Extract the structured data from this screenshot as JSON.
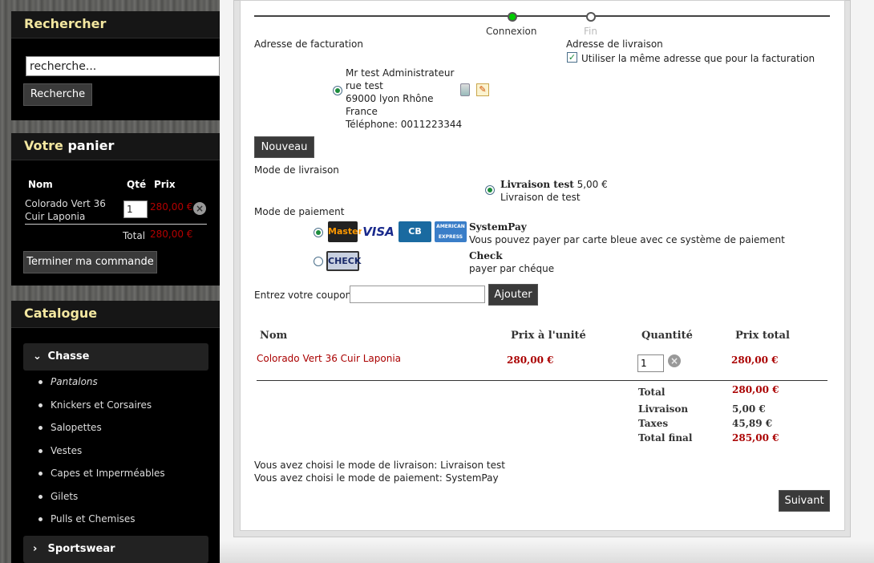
{
  "search": {
    "title": "Rechercher",
    "input_value": "recherche...",
    "button": "Recherche"
  },
  "cart": {
    "title_prefix": "Votre",
    "title_suffix": "panier",
    "col_name": "Nom",
    "col_qty": "Qté",
    "col_price": "Prix",
    "item_name_1": "Colorado Vert 36",
    "item_name_2": "Cuir Laponia",
    "item_qty": "1",
    "item_price": "280,00 €",
    "total_label": "Total",
    "total_value": "280,00 €",
    "checkout_button": "Terminer ma commande"
  },
  "catalog": {
    "title": "Catalogue",
    "group_open": "Chasse",
    "items": [
      "Pantalons",
      "Knickers et Corsaires",
      "Salopettes",
      "Vestes",
      "Capes et Imperméables",
      "Gilets",
      "Pulls et Chemises"
    ],
    "group_closed": "Sportswear"
  },
  "steps": {
    "current": "Connexion",
    "next": "Fin"
  },
  "billing": {
    "label": "Adresse de facturation",
    "name": "Mr test Administrateur",
    "street": "rue test",
    "city": "69000 lyon Rhône",
    "country": "France",
    "phone": "Téléphone: 0011223344",
    "new_button": "Nouveau"
  },
  "delivery_address": {
    "label": "Adresse de livraison",
    "same_checkbox": "Utiliser la même adresse que pour la facturation"
  },
  "shipping": {
    "label": "Mode de livraison",
    "option_name": "Livraison test",
    "option_price": "5,00 €",
    "option_desc": "Livraison de test"
  },
  "payment": {
    "label": "Mode de paiement",
    "logos": [
      "MasterCard",
      "VISA",
      "CB",
      "AMERICAN EXPRESS",
      "CHECK"
    ],
    "option1_name": "SystemPay",
    "option1_desc": "Vous pouvez payer par carte bleue avec ce système de paiement",
    "option2_name": "Check",
    "option2_desc": "payer par chéque"
  },
  "coupon": {
    "label": "Entrez votre coupon",
    "button": "Ajouter"
  },
  "order_table": {
    "headers": [
      "Nom",
      "Prix à l'unité",
      "Quantité",
      "Prix total"
    ],
    "row": {
      "name": "Colorado Vert 36 Cuir Laponia",
      "unit_price": "280,00 €",
      "qty": "1",
      "total": "280,00 €"
    },
    "totals": {
      "total_label": "Total",
      "total_value": "280,00 €",
      "shipping_label": "Livraison",
      "shipping_value": "5,00 €",
      "taxes_label": "Taxes",
      "taxes_value": "45,89 €",
      "final_label": "Total final",
      "final_value": "285,00 €"
    }
  },
  "summary": {
    "shipping_line": "Vous avez choisi le mode de livraison: Livraison test",
    "payment_line": "Vous avez choisi le mode de paiement: SystemPay"
  },
  "next_button": "Suivant",
  "colors": {
    "accent_yellow": "#f3e7a0",
    "price_red": "#aa0000",
    "button_dark": "#3a3a3a",
    "step_active": "#00cc00"
  }
}
